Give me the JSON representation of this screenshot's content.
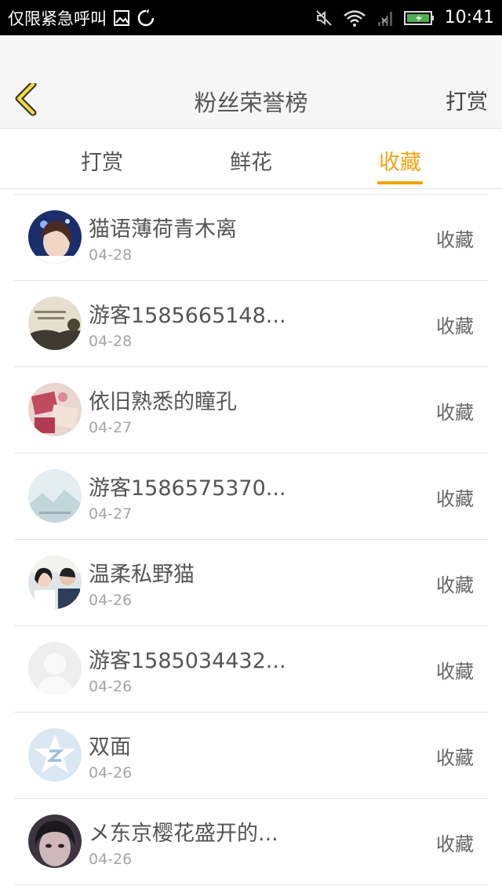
{
  "status_bar": {
    "left_text": "仅限紧急呼叫",
    "time": "10:41"
  },
  "header": {
    "title": "粉丝荣誉榜",
    "action_label": "打赏",
    "back_icon": "chevron-left-icon",
    "accent_color": "#f2a413"
  },
  "tabs": [
    {
      "label": "打赏",
      "active": false
    },
    {
      "label": "鲜花",
      "active": false
    },
    {
      "label": "收藏",
      "active": true
    }
  ],
  "items": [
    {
      "name": "猫语薄荷青木离",
      "date": "04-28",
      "action": "收藏"
    },
    {
      "name": "游客1585665148...",
      "date": "04-28",
      "action": "收藏"
    },
    {
      "name": "依旧熟悉的瞳孔",
      "date": "04-27",
      "action": "收藏"
    },
    {
      "name": "游客1586575370...",
      "date": "04-27",
      "action": "收藏"
    },
    {
      "name": "温柔私野猫",
      "date": "04-26",
      "action": "收藏"
    },
    {
      "name": "游客1585034432...",
      "date": "04-26",
      "action": "收藏"
    },
    {
      "name": "双面",
      "date": "04-26",
      "action": "收藏"
    },
    {
      "name": "メ东京樱花盛开的...",
      "date": "04-26",
      "action": "收藏"
    }
  ]
}
